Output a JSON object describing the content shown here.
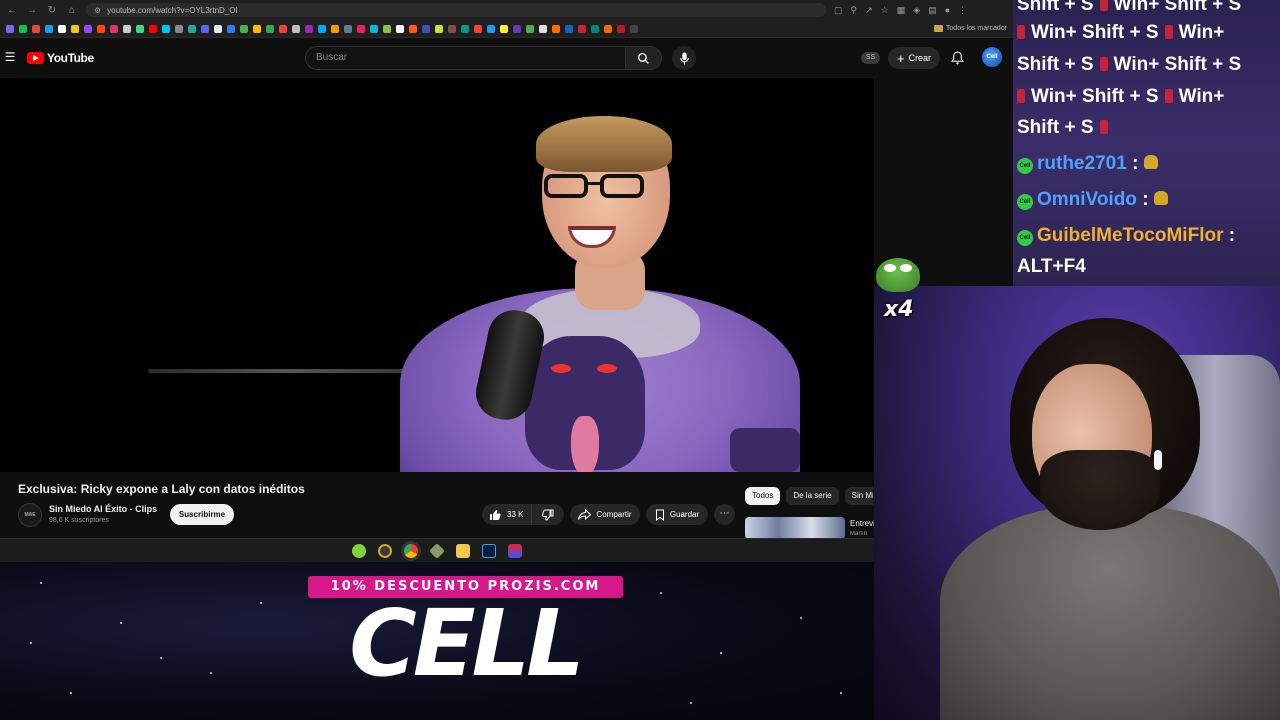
{
  "browser": {
    "url": "youtube.com/watch?v=OYL3rtnD_OI",
    "bookmarks_folder": "Todos los marcador"
  },
  "youtube": {
    "logo_text": "YouTube",
    "search_placeholder": "Buscar",
    "ss_badge": "SS",
    "create_label": "Crear",
    "avatar_text": "Cell"
  },
  "video": {
    "title": "Exclusiva: Ricky expone a Laly con datos inéditos",
    "channel_avatar_text": "MAE",
    "channel_name": "Sin Miedo Al Éxito - Clips",
    "subscribers": "98,6 K suscriptores",
    "subscribe_label": "Suscribirme",
    "likes": "33 K",
    "share_label": "Compartir",
    "save_label": "Guardar"
  },
  "sidebar": {
    "chips": [
      {
        "label": "Todos",
        "active": true
      },
      {
        "label": "De la serie",
        "active": false
      },
      {
        "label": "Sin Miedo",
        "active": false
      }
    ],
    "recommended": {
      "title": "Entrevista",
      "channel": "Martín"
    }
  },
  "promo": {
    "banner": "10% DESCUENTO PROZIS.COM",
    "word": "CELL"
  },
  "chat": {
    "spam_lines": [
      "Shift + S",
      "Win+ Shift + S",
      "Win+ Shift + S",
      "Win+",
      "Shift + S",
      "Win+ Shift + S",
      "Win+ Shift + S",
      "Win+",
      "Shift + S"
    ],
    "messages": [
      {
        "user": "ruthe2701",
        "color": "#4fa0ff",
        "text": ":"
      },
      {
        "user": "OmniVoido",
        "color": "#4fa0ff",
        "text": ":"
      },
      {
        "user": "GuibelMeTocoMiFlor",
        "color": "#f0b030",
        "text": ":"
      }
    ],
    "last_line": "ALT+F4",
    "badge_text": "Cell"
  },
  "emote": {
    "multiplier": "x4"
  },
  "colors": {
    "youtube_red": "#ff0000",
    "promo_pink": "#d6188b",
    "chat_bg": "#2a2250"
  }
}
